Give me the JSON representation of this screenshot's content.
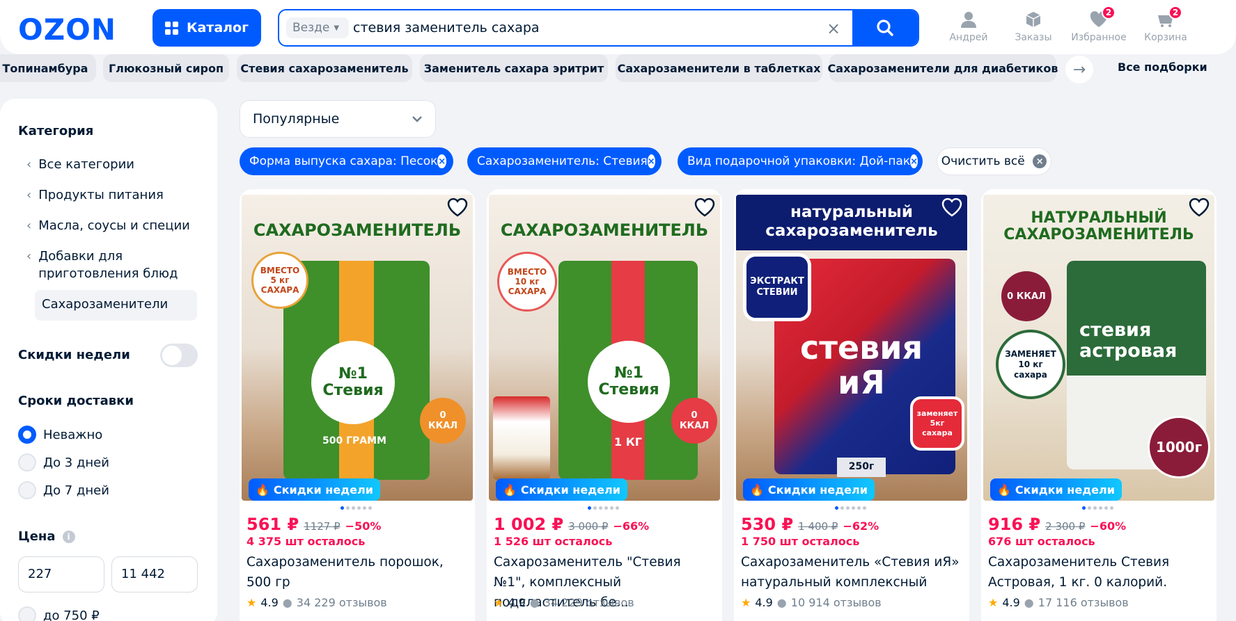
{
  "header": {
    "logo": "OZON",
    "catalog_label": "Каталог",
    "search": {
      "scope": "Везде",
      "query": "стевия заменитель сахара"
    },
    "user_label": "Андрей",
    "orders_label": "Заказы",
    "favorites_label": "Избранное",
    "favorites_count": "2",
    "cart_label": "Корзина",
    "cart_count": "2"
  },
  "tags": [
    "Топинамбура",
    "Глюкозный сироп",
    "Стевия сахарозаменитель",
    "Заменитель сахара эритрит",
    "Сахарозаменители в таблетках",
    "Сахарозаменители для диабетиков"
  ],
  "all_collections": "Все подборки",
  "sidebar": {
    "category_title": "Категория",
    "categories": [
      "Все категории",
      "Продукты питания",
      "Масла, соусы и специи",
      "Добавки для приготовления блюд"
    ],
    "current_category": "Сахарозаменители",
    "weekly_discounts": "Скидки недели",
    "delivery_title": "Сроки доставки",
    "delivery_options": [
      "Неважно",
      "До 3 дней",
      "До 7 дней"
    ],
    "price_title": "Цена",
    "price_from": "227",
    "price_to": "11 442",
    "price_option": "до 750 ₽"
  },
  "sort": "Популярные",
  "filters": [
    "Форма выпуска сахара: Песок",
    "Сахарозаменитель: Стевия",
    "Вид подарочной упаковки: Дой-пак"
  ],
  "clear_all": "Очистить всё",
  "promo_label": "Скидки недели",
  "products": [
    {
      "heading": "САХАРОЗАМЕНИТЕЛЬ",
      "badge": "ВМЕСТО 5 кг САХАРА",
      "pack_name": "№1 Стевия",
      "pack_weight": "500 ГРАММ",
      "kcal": "0 ККАЛ",
      "price": "561 ₽",
      "old_price": "1127 ₽",
      "discount": "−50%",
      "stock": "4 375 шт осталось",
      "title": "Сахарозаменитель порошок, 500 гр",
      "rating": "4.9",
      "reviews": "34 229 отзывов"
    },
    {
      "heading": "САХАРОЗАМЕНИТЕЛЬ",
      "badge": "ВМЕСТО 10 кг САХАРА",
      "pack_name": "№1 Стевия",
      "pack_weight": "1 КГ",
      "kcal": "0 ККАЛ",
      "price": "1 002 ₽",
      "old_price": "3 000 ₽",
      "discount": "−66%",
      "stock": "1 526 шт осталось",
      "title": "Сахарозаменитель \"Стевия №1\", комплексный подсластитель бе...",
      "rating": "4.9",
      "reviews": "34 229 отзывов"
    },
    {
      "heading": "натуральный сахарозаменитель",
      "badge": "ЭКСТРАКТ СТЕВИИ",
      "pack_name": "стевия иЯ",
      "pack_weight": "250г",
      "kcal": "заменяет 5кг сахара",
      "price": "530 ₽",
      "old_price": "1 400 ₽",
      "discount": "−62%",
      "stock": "1 750 шт осталось",
      "title": "Сахарозаменитель «Стевия иЯ» натуральный комплексный",
      "rating": "4.9",
      "reviews": "10 914 отзывов"
    },
    {
      "heading": "НАТУРАЛЬНЫЙ САХАРОЗАМЕНИТЕЛЬ",
      "badge": "0 ККАЛ",
      "pack_name": "стевия астровая",
      "pack_weight": "1000г",
      "kcal": "ЗАМЕНЯЕТ 10 кг сахара",
      "price": "916 ₽",
      "old_price": "2 300 ₽",
      "discount": "−60%",
      "stock": "676 шт осталось",
      "title": "Сахарозаменитель Стевия Астровая, 1 кг. 0 калорий.",
      "rating": "4.9",
      "reviews": "17 116 отзывов"
    }
  ],
  "colors": {
    "accent": "#005bff",
    "price": "#f91155",
    "bg": "#f2f3f7"
  }
}
